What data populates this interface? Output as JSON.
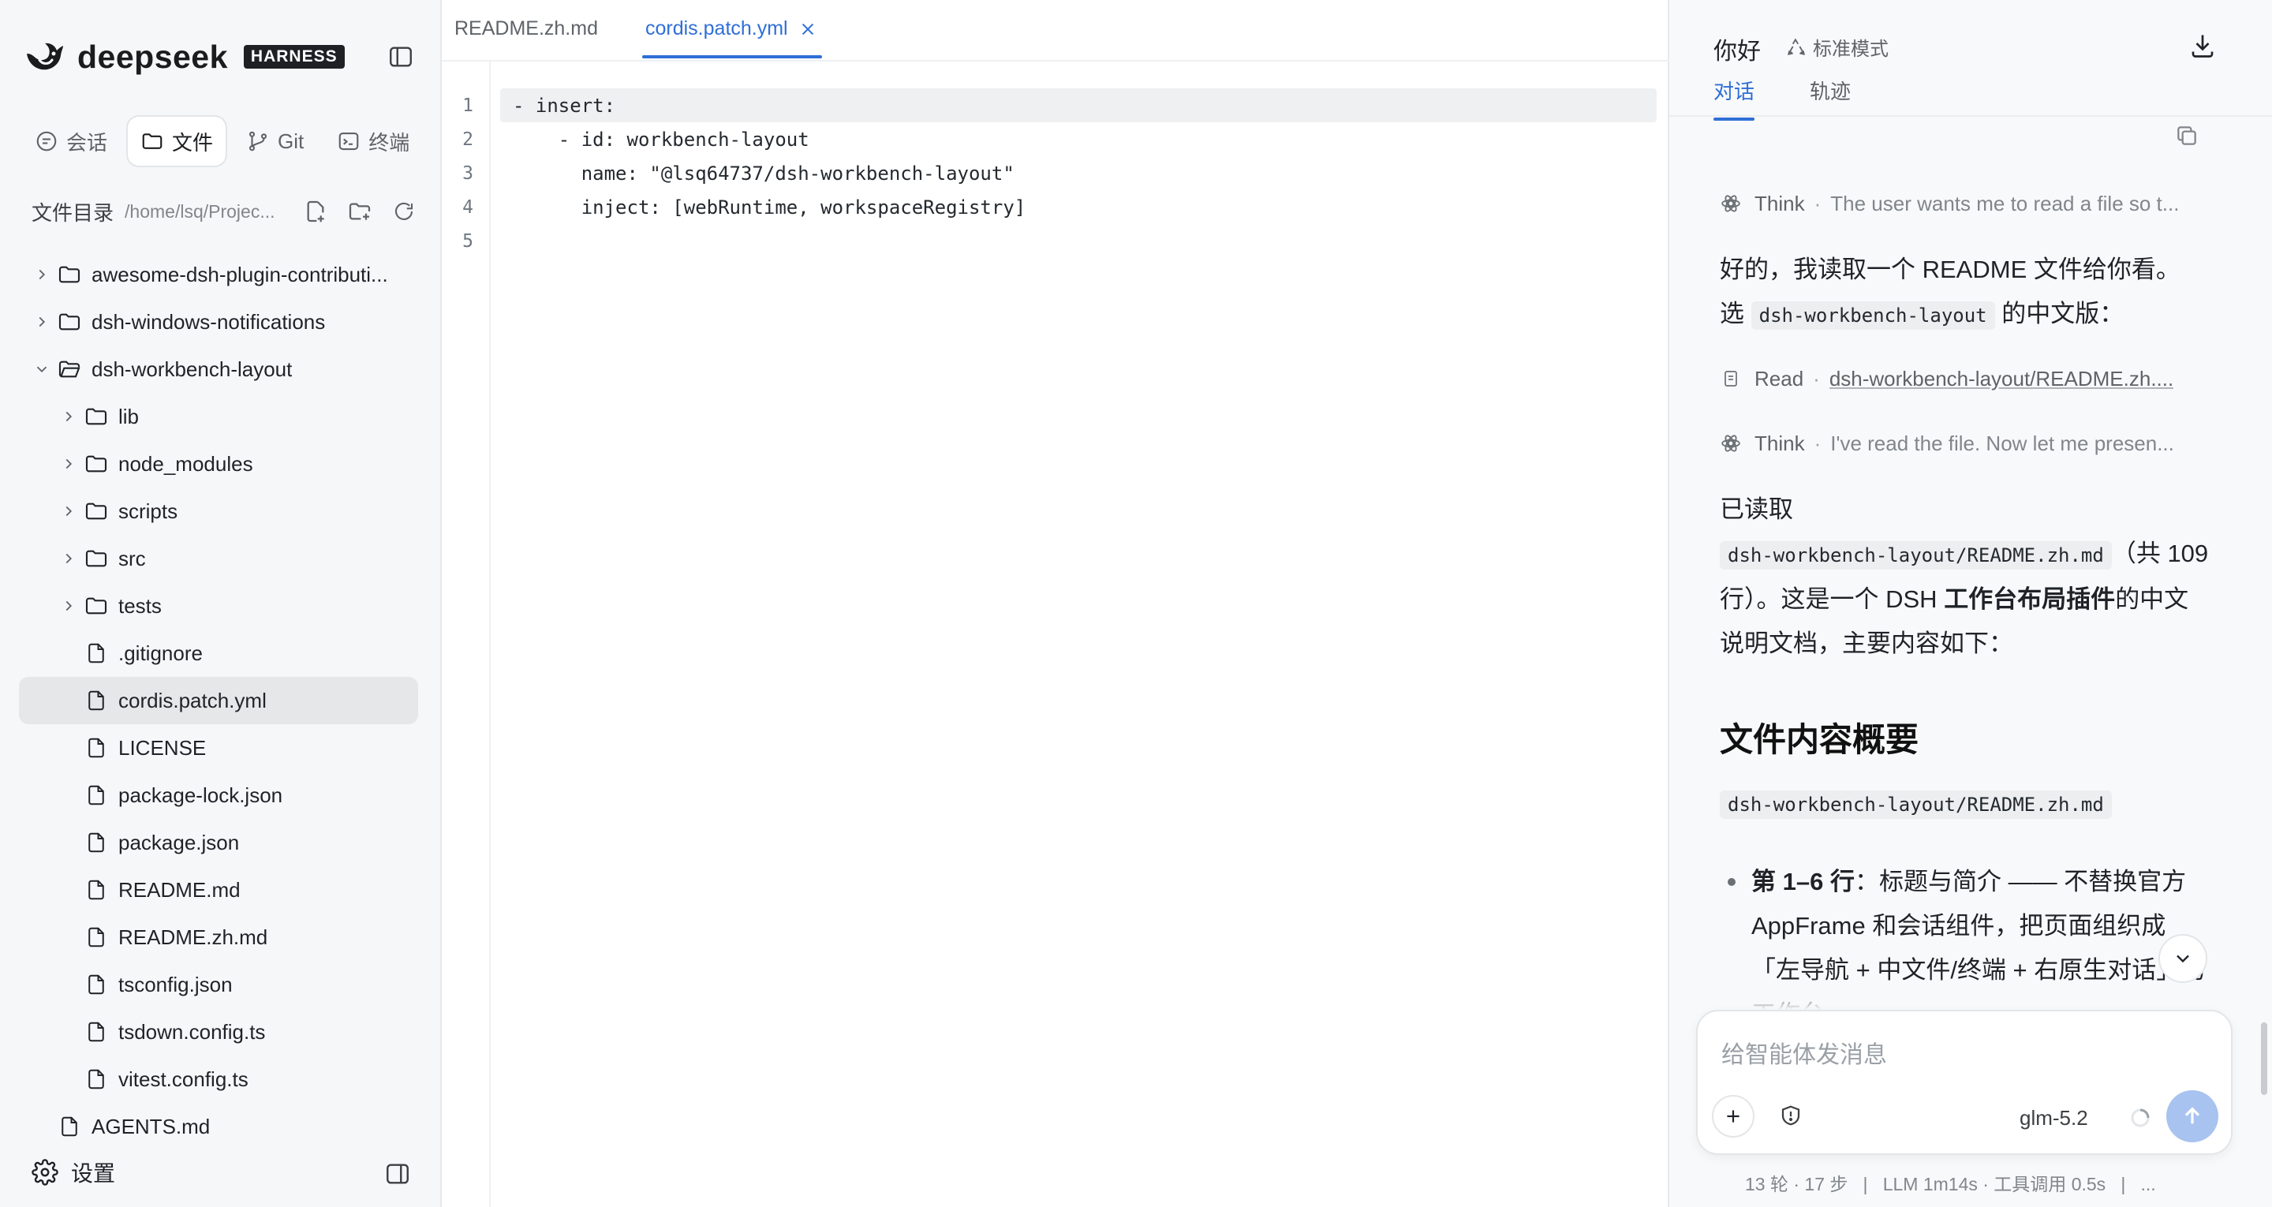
{
  "brand": {
    "name": "deepseek",
    "badge": "HARNESS"
  },
  "sidebar": {
    "tabs": [
      {
        "label": "会话",
        "icon": "chat-icon",
        "active": false
      },
      {
        "label": "文件",
        "icon": "folder-icon",
        "active": true
      },
      {
        "label": "Git",
        "icon": "git-branch-icon",
        "active": false
      },
      {
        "label": "终端",
        "icon": "terminal-icon",
        "active": false
      }
    ],
    "directory": {
      "title": "文件目录",
      "path": "/home/lsq/Projec..."
    },
    "tree": [
      {
        "label": "awesome-dsh-plugin-contributi...",
        "type": "folder",
        "depth": 0,
        "expanded": false
      },
      {
        "label": "dsh-windows-notifications",
        "type": "folder",
        "depth": 0,
        "expanded": false
      },
      {
        "label": "dsh-workbench-layout",
        "type": "folder",
        "depth": 0,
        "expanded": true
      },
      {
        "label": "lib",
        "type": "folder",
        "depth": 1,
        "expanded": false
      },
      {
        "label": "node_modules",
        "type": "folder",
        "depth": 1,
        "expanded": false
      },
      {
        "label": "scripts",
        "type": "folder",
        "depth": 1,
        "expanded": false
      },
      {
        "label": "src",
        "type": "folder",
        "depth": 1,
        "expanded": false
      },
      {
        "label": "tests",
        "type": "folder",
        "depth": 1,
        "expanded": false
      },
      {
        "label": ".gitignore",
        "type": "file",
        "depth": 1
      },
      {
        "label": "cordis.patch.yml",
        "type": "file",
        "depth": 1,
        "selected": true
      },
      {
        "label": "LICENSE",
        "type": "file",
        "depth": 1
      },
      {
        "label": "package-lock.json",
        "type": "file",
        "depth": 1
      },
      {
        "label": "package.json",
        "type": "file",
        "depth": 1
      },
      {
        "label": "README.md",
        "type": "file",
        "depth": 1
      },
      {
        "label": "README.zh.md",
        "type": "file",
        "depth": 1
      },
      {
        "label": "tsconfig.json",
        "type": "file",
        "depth": 1
      },
      {
        "label": "tsdown.config.ts",
        "type": "file",
        "depth": 1
      },
      {
        "label": "vitest.config.ts",
        "type": "file",
        "depth": 1
      },
      {
        "label": "AGENTS.md",
        "type": "file",
        "depth": 0
      }
    ],
    "settings_label": "设置"
  },
  "editor": {
    "tabs": [
      {
        "label": "README.zh.md",
        "active": false
      },
      {
        "label": "cordis.patch.yml",
        "active": true
      }
    ],
    "lines": [
      {
        "n": "1",
        "text": "- insert:"
      },
      {
        "n": "2",
        "text": "    - id: workbench-layout"
      },
      {
        "n": "3",
        "text": "      name: \"@lsq64737/dsh-workbench-layout\""
      },
      {
        "n": "4",
        "text": "      inject: [webRuntime, workspaceRegistry]"
      },
      {
        "n": "5",
        "text": ""
      }
    ]
  },
  "chat": {
    "title": "你好",
    "mode": "标准模式",
    "tabs": [
      {
        "label": "对话",
        "active": true
      },
      {
        "label": "轨迹",
        "active": false
      }
    ],
    "steps": {
      "think1": {
        "name": "Think",
        "desc": "The user wants me to read a file so t..."
      },
      "read": {
        "name": "Read",
        "link": "dsh-workbench-layout/README.zh...."
      },
      "think2": {
        "name": "Think",
        "desc": "I've read the file. Now let me presen..."
      }
    },
    "reply1": {
      "line1": "好的，我读取一个 README 文件给你看。",
      "pre": "选 ",
      "code": "dsh-workbench-layout",
      "post": " 的中文版："
    },
    "reply2": {
      "pre": "已读取",
      "code": "dsh-workbench-layout/README.zh.md",
      "mid": "（共 109 行）。这是一个 DSH ",
      "bold": "工作台布局插件",
      "post": "的中文说明文档，主要内容如下："
    },
    "heading": "文件内容概要",
    "heading_code": "dsh-workbench-layout/README.zh.md",
    "bullet": {
      "bold": "第 1–6 行",
      "text": "：标题与简介 —— 不替换官方 AppFrame 和会话组件，把页面组织成「左导航 + 中文件/终端 + 右原生对话」的工作台"
    },
    "composer": {
      "placeholder": "给智能体发消息",
      "model": "glm-5.2"
    },
    "status": "13 轮 · 17 步   |   LLM 1m14s · 工具调用 0.5s   |   ..."
  },
  "colors": {
    "accent": "#2f6fd6",
    "send_button": "#a8c3f0",
    "selected_row": "#e6e7e9"
  }
}
